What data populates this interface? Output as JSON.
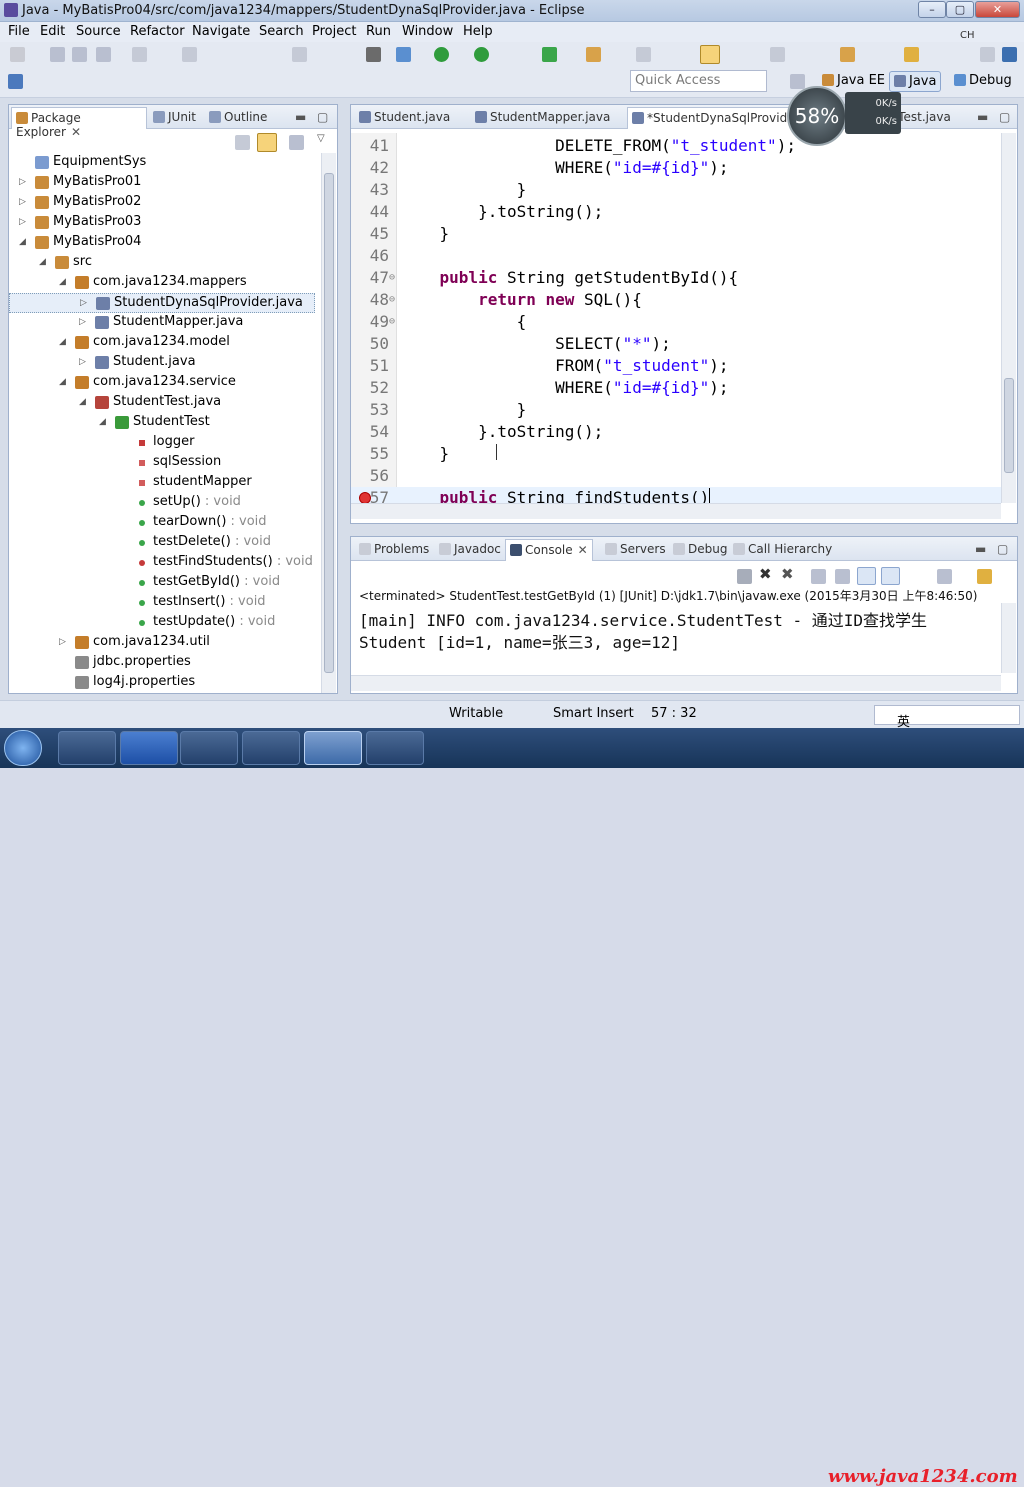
{
  "window": {
    "title": "Java - MyBatisPro04/src/com/java1234/mappers/StudentDynaSqlProvider.java - Eclipse"
  },
  "window_controls": {
    "minimize": "–",
    "maximize": "▢",
    "close": "✕",
    "ime": "CH"
  },
  "menu": [
    "File",
    "Edit",
    "Source",
    "Refactor",
    "Navigate",
    "Search",
    "Project",
    "Run",
    "Window",
    "Help"
  ],
  "quick_access": {
    "placeholder": "Quick Access"
  },
  "perspectives": [
    "Java EE",
    "Java",
    "Debug"
  ],
  "left_tabs": [
    "Package Explorer",
    "JUnit",
    "Outline"
  ],
  "tree": [
    {
      "label": "EquipmentSys",
      "level": 0,
      "twisty": "",
      "icon": "folder-icon",
      "color": "#7b9bd0"
    },
    {
      "label": "MyBatisPro01",
      "level": 0,
      "twisty": "▷",
      "icon": "project-icon",
      "color": "#c98b3a"
    },
    {
      "label": "MyBatisPro02",
      "level": 0,
      "twisty": "▷",
      "icon": "project-icon",
      "color": "#c98b3a"
    },
    {
      "label": "MyBatisPro03",
      "level": 0,
      "twisty": "▷",
      "icon": "project-icon",
      "color": "#c98b3a"
    },
    {
      "label": "MyBatisPro04",
      "level": 0,
      "twisty": "◢",
      "icon": "project-error-icon",
      "color": "#c98b3a"
    },
    {
      "label": "src",
      "level": 1,
      "twisty": "◢",
      "icon": "source-folder-icon",
      "color": "#c98b3a"
    },
    {
      "label": "com.java1234.mappers",
      "level": 2,
      "twisty": "◢",
      "icon": "package-icon",
      "color": "#c47d2a"
    },
    {
      "label": "StudentDynaSqlProvider.java",
      "level": 3,
      "twisty": "▷",
      "icon": "java-file-icon",
      "color": "#6d7fa8",
      "selected": true
    },
    {
      "label": "StudentMapper.java",
      "level": 3,
      "twisty": "▷",
      "icon": "java-file-icon",
      "color": "#6d7fa8"
    },
    {
      "label": "com.java1234.model",
      "level": 2,
      "twisty": "◢",
      "icon": "package-icon",
      "color": "#c47d2a"
    },
    {
      "label": "Student.java",
      "level": 3,
      "twisty": "▷",
      "icon": "java-file-icon",
      "color": "#6d7fa8"
    },
    {
      "label": "com.java1234.service",
      "level": 2,
      "twisty": "◢",
      "icon": "package-icon",
      "color": "#c47d2a"
    },
    {
      "label": "StudentTest.java",
      "level": 3,
      "twisty": "◢",
      "icon": "java-file-error-icon",
      "color": "#b5443b"
    },
    {
      "label": "StudentTest",
      "level": 4,
      "twisty": "◢",
      "icon": "class-icon",
      "color": "#3a9a3a"
    },
    {
      "label": "logger",
      "level": 5,
      "twisty": "",
      "icon": "static-field-icon",
      "color": "#c53a3a"
    },
    {
      "label": "sqlSession",
      "level": 5,
      "twisty": "",
      "icon": "private-field-icon",
      "color": "#d25c5c"
    },
    {
      "label": "studentMapper",
      "level": 5,
      "twisty": "",
      "icon": "private-field-icon",
      "color": "#d25c5c"
    },
    {
      "label": "setUp()",
      "suffix": " : void",
      "level": 5,
      "twisty": "",
      "icon": "method-icon",
      "color": "#3aa64a"
    },
    {
      "label": "tearDown()",
      "suffix": " : void",
      "level": 5,
      "twisty": "",
      "icon": "method-icon",
      "color": "#3aa64a"
    },
    {
      "label": "testDelete()",
      "suffix": " : void",
      "level": 5,
      "twisty": "",
      "icon": "method-icon",
      "color": "#3aa64a"
    },
    {
      "label": "testFindStudents()",
      "suffix": " : void",
      "level": 5,
      "twisty": "",
      "icon": "method-error-icon",
      "color": "#c53a3a"
    },
    {
      "label": "testGetById()",
      "suffix": " : void",
      "level": 5,
      "twisty": "",
      "icon": "method-icon",
      "color": "#3aa64a"
    },
    {
      "label": "testInsert()",
      "suffix": " : void",
      "level": 5,
      "twisty": "",
      "icon": "method-icon",
      "color": "#3aa64a"
    },
    {
      "label": "testUpdate()",
      "suffix": " : void",
      "level": 5,
      "twisty": "",
      "icon": "method-icon",
      "color": "#3aa64a"
    },
    {
      "label": "com.java1234.util",
      "level": 2,
      "twisty": "▷",
      "icon": "package-icon",
      "color": "#c47d2a"
    },
    {
      "label": "jdbc.properties",
      "level": 2,
      "twisty": "",
      "icon": "properties-file-icon",
      "color": "#8a8a8a"
    },
    {
      "label": "log4j.properties",
      "level": 2,
      "twisty": "",
      "icon": "properties-file-icon",
      "color": "#8a8a8a"
    }
  ],
  "editor_tabs": [
    {
      "label": "Student.java",
      "active": false
    },
    {
      "label": "StudentMapper.java",
      "active": false
    },
    {
      "label": "*StudentDynaSqlProvider.java",
      "active": true
    },
    {
      "label": "StudentTest.java",
      "active": false
    }
  ],
  "code": [
    {
      "n": "41",
      "fold": "",
      "parts": [
        {
          "t": "                DELETE_FROM("
        },
        {
          "t": "\"t_student\"",
          "c": "st"
        },
        {
          "t": ");"
        }
      ]
    },
    {
      "n": "42",
      "fold": "",
      "parts": [
        {
          "t": "                WHERE("
        },
        {
          "t": "\"id=#{id}\"",
          "c": "st"
        },
        {
          "t": ");"
        }
      ]
    },
    {
      "n": "43",
      "fold": "",
      "parts": [
        {
          "t": "            }"
        }
      ]
    },
    {
      "n": "44",
      "fold": "",
      "parts": [
        {
          "t": "        }.toString();"
        }
      ]
    },
    {
      "n": "45",
      "fold": "",
      "parts": [
        {
          "t": "    }"
        }
      ]
    },
    {
      "n": "46",
      "fold": "",
      "parts": [
        {
          "t": ""
        }
      ]
    },
    {
      "n": "47",
      "fold": "⊖",
      "parts": [
        {
          "t": "    "
        },
        {
          "t": "public",
          "c": "kw"
        },
        {
          "t": " String getStudentById(){"
        }
      ]
    },
    {
      "n": "48",
      "fold": "⊖",
      "parts": [
        {
          "t": "        "
        },
        {
          "t": "return",
          "c": "kw"
        },
        {
          "t": " "
        },
        {
          "t": "new",
          "c": "kw"
        },
        {
          "t": " SQL(){"
        }
      ]
    },
    {
      "n": "49",
      "fold": "⊖",
      "parts": [
        {
          "t": "            {"
        }
      ]
    },
    {
      "n": "50",
      "fold": "",
      "parts": [
        {
          "t": "                SELECT("
        },
        {
          "t": "\"*\"",
          "c": "st"
        },
        {
          "t": ");"
        }
      ]
    },
    {
      "n": "51",
      "fold": "",
      "parts": [
        {
          "t": "                FROM("
        },
        {
          "t": "\"t_student\"",
          "c": "st"
        },
        {
          "t": ");"
        }
      ]
    },
    {
      "n": "52",
      "fold": "",
      "parts": [
        {
          "t": "                WHERE("
        },
        {
          "t": "\"id=#{id}\"",
          "c": "st"
        },
        {
          "t": ");"
        }
      ]
    },
    {
      "n": "53",
      "fold": "",
      "parts": [
        {
          "t": "            }"
        }
      ]
    },
    {
      "n": "54",
      "fold": "",
      "parts": [
        {
          "t": "        }.toString();"
        }
      ]
    },
    {
      "n": "55",
      "fold": "",
      "parts": [
        {
          "t": "    }"
        }
      ]
    },
    {
      "n": "56",
      "fold": "",
      "parts": [
        {
          "t": ""
        }
      ]
    },
    {
      "n": "57",
      "fold": "",
      "error": true,
      "current": true,
      "parts": [
        {
          "t": "    "
        },
        {
          "t": "public",
          "c": "kw"
        },
        {
          "t": " String findStudents()"
        }
      ]
    }
  ],
  "bottom_tabs": [
    "Problems",
    "Javadoc",
    "Console",
    "Servers",
    "Debug",
    "Call Hierarchy"
  ],
  "console": {
    "header": "<terminated> StudentTest.testGetById (1) [JUnit] D:\\jdk1.7\\bin\\javaw.exe (2015年3月30日 上午8:46:50)",
    "lines": [
      "[main] INFO com.java1234.service.StudentTest - 通过ID查找学生",
      "Student [id=1, name=张三3, age=12]"
    ]
  },
  "status": {
    "writable": "Writable",
    "insert": "Smart Insert",
    "position": "57 : 32"
  },
  "ime_tray": "英",
  "overlay": {
    "percent": "58%",
    "up": "0K/s",
    "down": "0K/s"
  },
  "watermark": "www.java1234.com",
  "colors": {
    "keyword": "#7f0055",
    "string": "#2a00ff",
    "current_line": "#e8f2fe",
    "error": "#e03434"
  }
}
